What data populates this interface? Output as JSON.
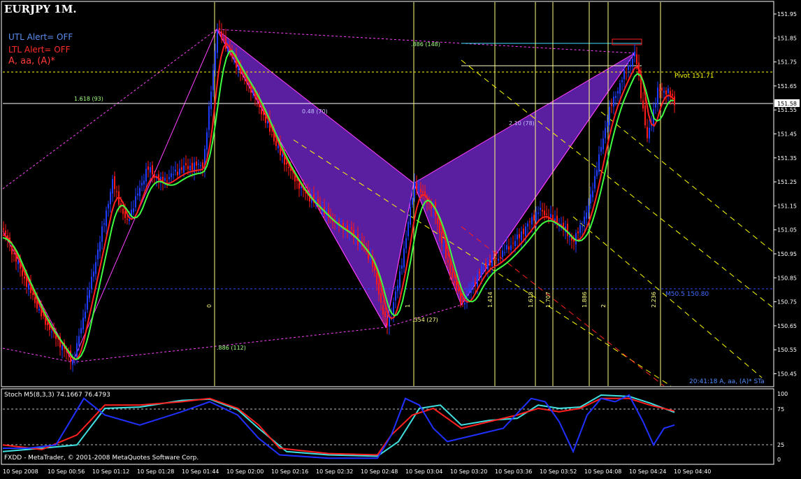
{
  "window": {
    "title": "EURJPY 1M.",
    "utl_alert": "UTL Alert= OFF",
    "ltl_alert": "LTL Alert= OFF",
    "pattern_name": "A, aa, (A)*"
  },
  "price_axis": {
    "ticks": [
      "151.95",
      "151.85",
      "151.75",
      "151.65",
      "151.55",
      "151.45",
      "151.35",
      "151.25",
      "151.15",
      "151.05",
      "150.95",
      "150.85",
      "150.75",
      "150.65",
      "150.55",
      "150.45"
    ],
    "current_price": "151.58"
  },
  "time_axis": {
    "ticks": [
      "10 Sep 2008",
      "10 Sep 00:56",
      "10 Sep 01:12",
      "10 Sep 01:28",
      "10 Sep 01:44",
      "10 Sep 02:00",
      "10 Sep 02:16",
      "10 Sep 02:32",
      "10 Sep 02:48",
      "10 Sep 03:04",
      "10 Sep 03:20",
      "10 Sep 03:36",
      "10 Sep 03:52",
      "10 Sep 04:08",
      "10 Sep 04:24",
      "10 Sep 04:40"
    ]
  },
  "annotations": {
    "fib_top": ".886 (148)",
    "fib_left": "1.618 (93)",
    "fib_mid": "0.48 (70)",
    "fib_right": "2.10 (78)",
    "fib_bottom_left": ".886 (112)",
    "fib_bottom_mid": ".354 (27)",
    "pivot": "Pivot   151.71",
    "ma": "M50.5   150.80",
    "clock": "20:41:18   A, aa, (A)* STa",
    "vlines": [
      "0",
      "1",
      "1.414",
      "1.618",
      "1.707",
      "1.886",
      "2",
      "2.236"
    ]
  },
  "stochastic": {
    "label": "Stoch M5(8,3,3)  74.1667 76.4793",
    "levels": [
      "100",
      "75",
      "25",
      "0"
    ]
  },
  "footer": {
    "copyright": "FXDD - MetaTrader, © 2001-2008 MetaQuotes Software Corp."
  },
  "colors": {
    "background": "#000000",
    "pattern_fill": "#5a1fa0",
    "bull_candle": "#1e3cff",
    "bear_candle": "#ff1a1a",
    "fast_ma": "#40ff40",
    "slow_ma": "#ff2020",
    "fib_vertical": "#ffff80",
    "pattern_line": "#ff40ff"
  }
}
